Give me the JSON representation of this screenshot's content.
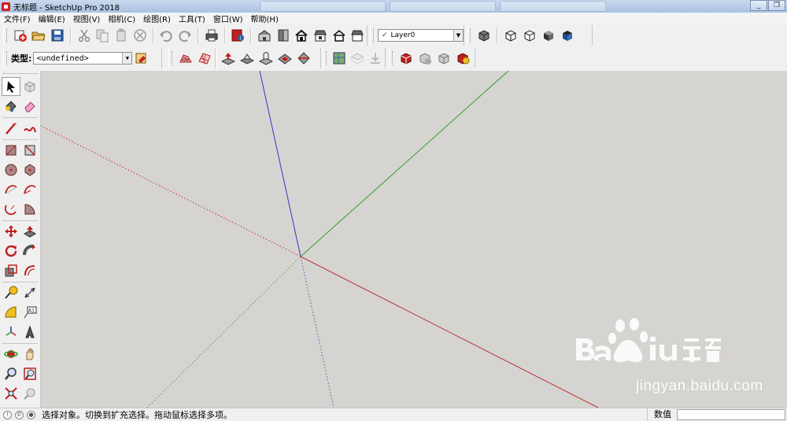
{
  "window": {
    "title": "无标题 - SketchUp Pro 2018",
    "controls": [
      "minimize-icon",
      "restore-icon",
      "close-icon"
    ]
  },
  "menu": [
    "文件(F)",
    "编辑(E)",
    "视图(V)",
    "相机(C)",
    "绘图(R)",
    "工具(T)",
    "窗口(W)",
    "帮助(H)"
  ],
  "layer_select": {
    "value": "Layer0",
    "check": "✓"
  },
  "entity_type": {
    "label": "类型:",
    "value": "<undefined>"
  },
  "status": {
    "hint": "选择对象。切换到扩充选择。拖动鼠标选择多项。",
    "measurements_label": "数值",
    "measurements_value": ""
  },
  "watermark": {
    "url": "jingyan.baidu.com"
  },
  "colors": {
    "red_axis": "#c03030",
    "green_axis": "#2aa02a",
    "blue_axis": "#3030c0",
    "viewport_bg": "#d6d4d0"
  },
  "tools": {
    "toolbar_top": [
      "new-icon",
      "open-icon",
      "save-icon",
      "cut-icon",
      "copy-icon",
      "paste-icon",
      "erase-icon",
      "undo-icon",
      "redo-icon",
      "print-icon",
      "model-info-icon",
      "iso-view-icon",
      "top-view-icon",
      "front-view-icon",
      "right-view-icon",
      "back-view-icon",
      "left-view-icon"
    ],
    "styles": [
      "xray-icon",
      "wireframe-icon",
      "hidden-line-icon",
      "shaded-icon",
      "textured-icon"
    ],
    "palette": [
      "select-icon",
      "make-component-icon",
      "paint-bucket-icon",
      "eraser-icon",
      "line-icon",
      "freehand-icon",
      "rectangle-icon",
      "rotated-rectangle-icon",
      "circle-icon",
      "polygon-icon",
      "arc-icon",
      "2point-arc-icon",
      "3point-arc-icon",
      "pie-icon",
      "move-icon",
      "push-pull-icon",
      "rotate-icon",
      "follow-me-icon",
      "scale-icon",
      "offset-icon",
      "tape-measure-icon",
      "dimension-icon",
      "protractor-icon",
      "text-icon",
      "axes-icon",
      "3d-text-icon",
      "orbit-icon",
      "pan-icon",
      "zoom-icon",
      "zoom-window-icon",
      "zoom-extents-icon",
      "previous-view-icon"
    ]
  }
}
